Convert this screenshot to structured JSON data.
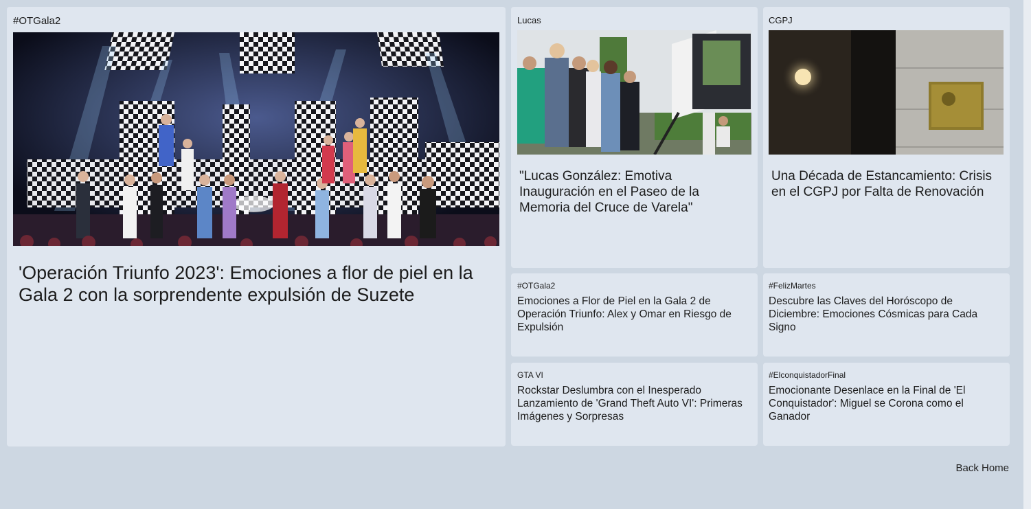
{
  "featured": {
    "tag": "#OTGala2",
    "title": "'Operación Triunfo 2023': Emociones a flor de piel en la Gala 2 con la sorprendente expulsión de Suzete"
  },
  "top_cards": [
    {
      "tag": "Lucas",
      "title": "\"Lucas González: Emotiva Inauguración en el Paseo de la Memoria del Cruce de Varela\""
    },
    {
      "tag": "CGPJ",
      "title": "Una Década de Estancamiento: Crisis en el CGPJ por Falta de Renovación"
    }
  ],
  "small_cards": [
    {
      "tag": "#OTGala2",
      "title": "Emociones a Flor de Piel en la Gala 2 de Operación Triunfo: Alex y Omar en Riesgo de Expulsión"
    },
    {
      "tag": "#FelizMartes",
      "title": "Descubre las Claves del Horóscopo de Diciembre: Emociones Cósmicas para Cada Signo"
    },
    {
      "tag": "GTA VI",
      "title": "Rockstar Deslumbra con el Inesperado Lanzamiento de 'Grand Theft Auto VI': Primeras Imágenes y Sorpresas"
    },
    {
      "tag": "#ElconquistadorFinal",
      "title": "Emocionante Desenlace en la Final de 'El Conquistador': Miguel se Corona como el Ganador"
    }
  ],
  "footer": {
    "back_home": "Back Home"
  }
}
